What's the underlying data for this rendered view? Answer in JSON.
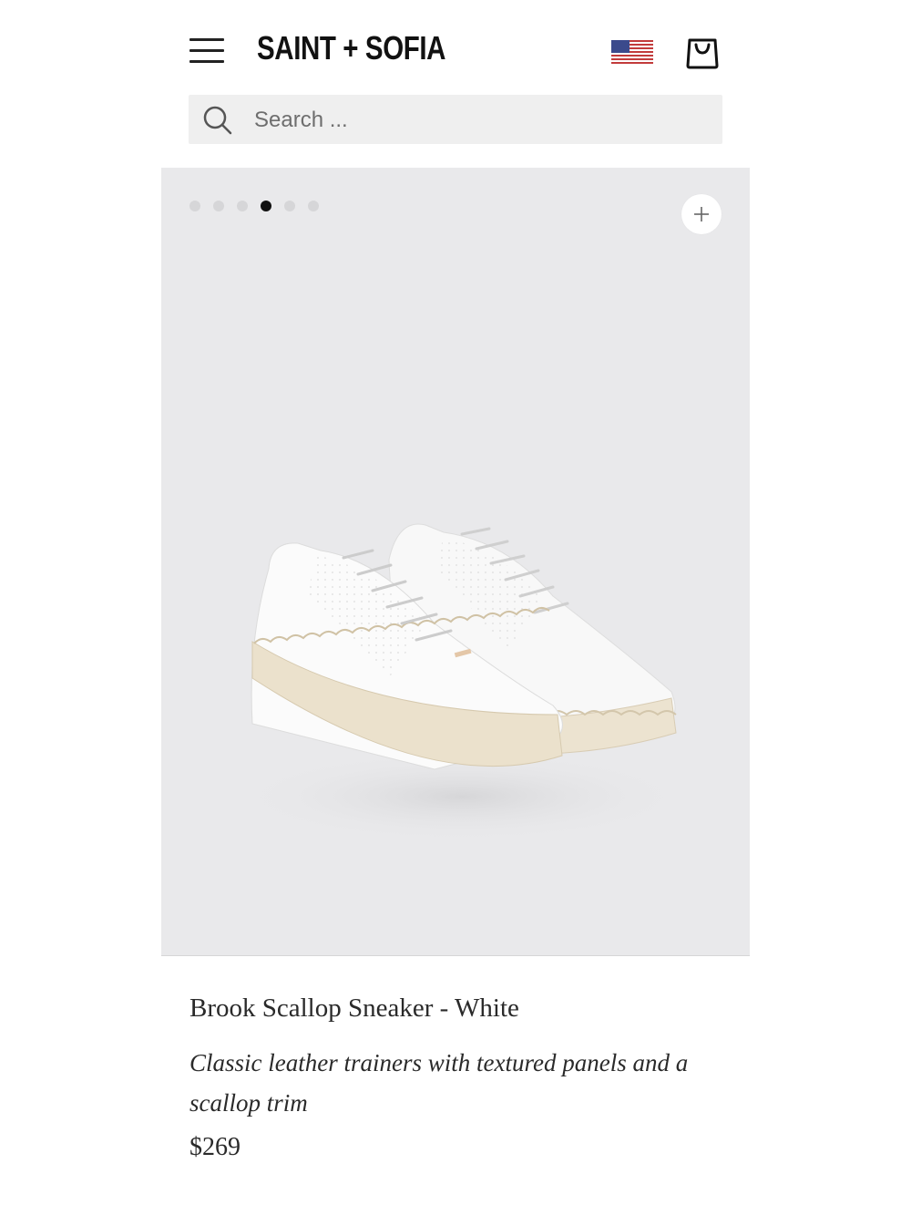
{
  "header": {
    "logo": "SAINT + SOFIA",
    "menu_icon": "hamburger-menu-icon",
    "flag_icon": "us-flag-icon",
    "bag_icon": "shopping-bag-icon"
  },
  "search": {
    "placeholder": "Search ...",
    "value": "",
    "icon": "search-icon"
  },
  "gallery": {
    "total_slides": 6,
    "active_slide": 4,
    "zoom_icon": "plus-icon",
    "image_alt": "white leather sneakers with scalloped beige sole",
    "background": "#e9e9eb"
  },
  "product": {
    "title": "Brook Scallop Sneaker - White",
    "description": "Classic leather trainers with textured panels and a scallop trim",
    "price": "$269"
  },
  "colors": {
    "text": "#2a2a2a",
    "active_dot": "#111111",
    "inactive_dot": "#d6d6d8",
    "search_bg": "#efefef"
  }
}
